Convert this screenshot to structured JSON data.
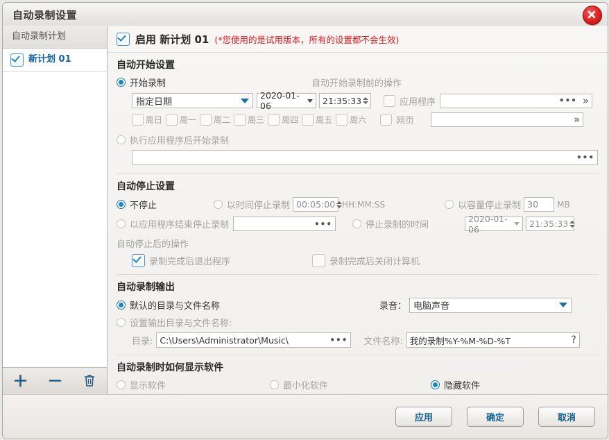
{
  "window": {
    "title": "自动录制设置",
    "close_icon": "close-icon"
  },
  "sidebar": {
    "header": "自动录制计划",
    "items": [
      {
        "label": "新计划 01",
        "checked": true
      }
    ],
    "toolbar": {
      "add": "+",
      "remove": "−",
      "delete_icon": "trash-icon"
    }
  },
  "main": {
    "enable": {
      "label": "启用 新计划 01",
      "checked": true,
      "trial_note": "(*您使用的是试用版本，所有的设置都不会生效)"
    },
    "start_section": {
      "title": "自动开始设置",
      "start_record_radio": "开始录制",
      "date_mode": "指定日期",
      "date_value": "2020-01-06",
      "time_value": "21:35:33",
      "weekdays": [
        "周日",
        "周一",
        "周二",
        "周三",
        "周四",
        "周五",
        "周六"
      ],
      "after_app_radio": "执行应用程序后开始录制",
      "app_path_value": "",
      "pre_actions_title": "自动开始录制前的操作",
      "app_label": "应用程序",
      "app_value": "",
      "web_label": "网页",
      "web_value": ""
    },
    "stop_section": {
      "title": "自动停止设置",
      "no_stop": "不停止",
      "by_time": "以时间停止录制",
      "time_value": "00:05:00",
      "time_format": "HH:MM:SS",
      "by_size": "以容量停止录制",
      "size_value": "30",
      "size_unit": "MB",
      "by_app_end": "以应用程序结束停止录制",
      "app_end_value": "",
      "stop_at_time": "停止录制的时间",
      "stop_date_value": "2020-01-06",
      "stop_time_value": "21:35:33",
      "after_stop_title": "自动停止后的操作",
      "exit_app": "录制完成后退出程序",
      "exit_app_checked": true,
      "shutdown": "录制完成后关闭计算机",
      "shutdown_checked": false
    },
    "output_section": {
      "title": "自动录制输出",
      "default_path": "默认的目录与文件名称",
      "custom_path": "设置输出目录与文件名称:",
      "dir_label": "目录:",
      "dir_value": "C:\\Users\\Administrator\\Music\\",
      "filename_label": "文件名称:",
      "filename_value": "我的录制%Y-%M-%D-%T",
      "help_icon": "?",
      "audio_label": "录音：",
      "audio_value": "电脑声音"
    },
    "display_section": {
      "title": "自动录制时如何显示软件",
      "options": [
        {
          "label": "显示软件",
          "selected": false
        },
        {
          "label": "最小化软件",
          "selected": false
        },
        {
          "label": "隐藏软件",
          "selected": true
        }
      ]
    }
  },
  "footer": {
    "apply": "应用",
    "ok": "确定",
    "cancel": "取消"
  },
  "colors": {
    "accent": "#1b86c8",
    "link": "#13628f",
    "warning": "#e01b1b"
  }
}
